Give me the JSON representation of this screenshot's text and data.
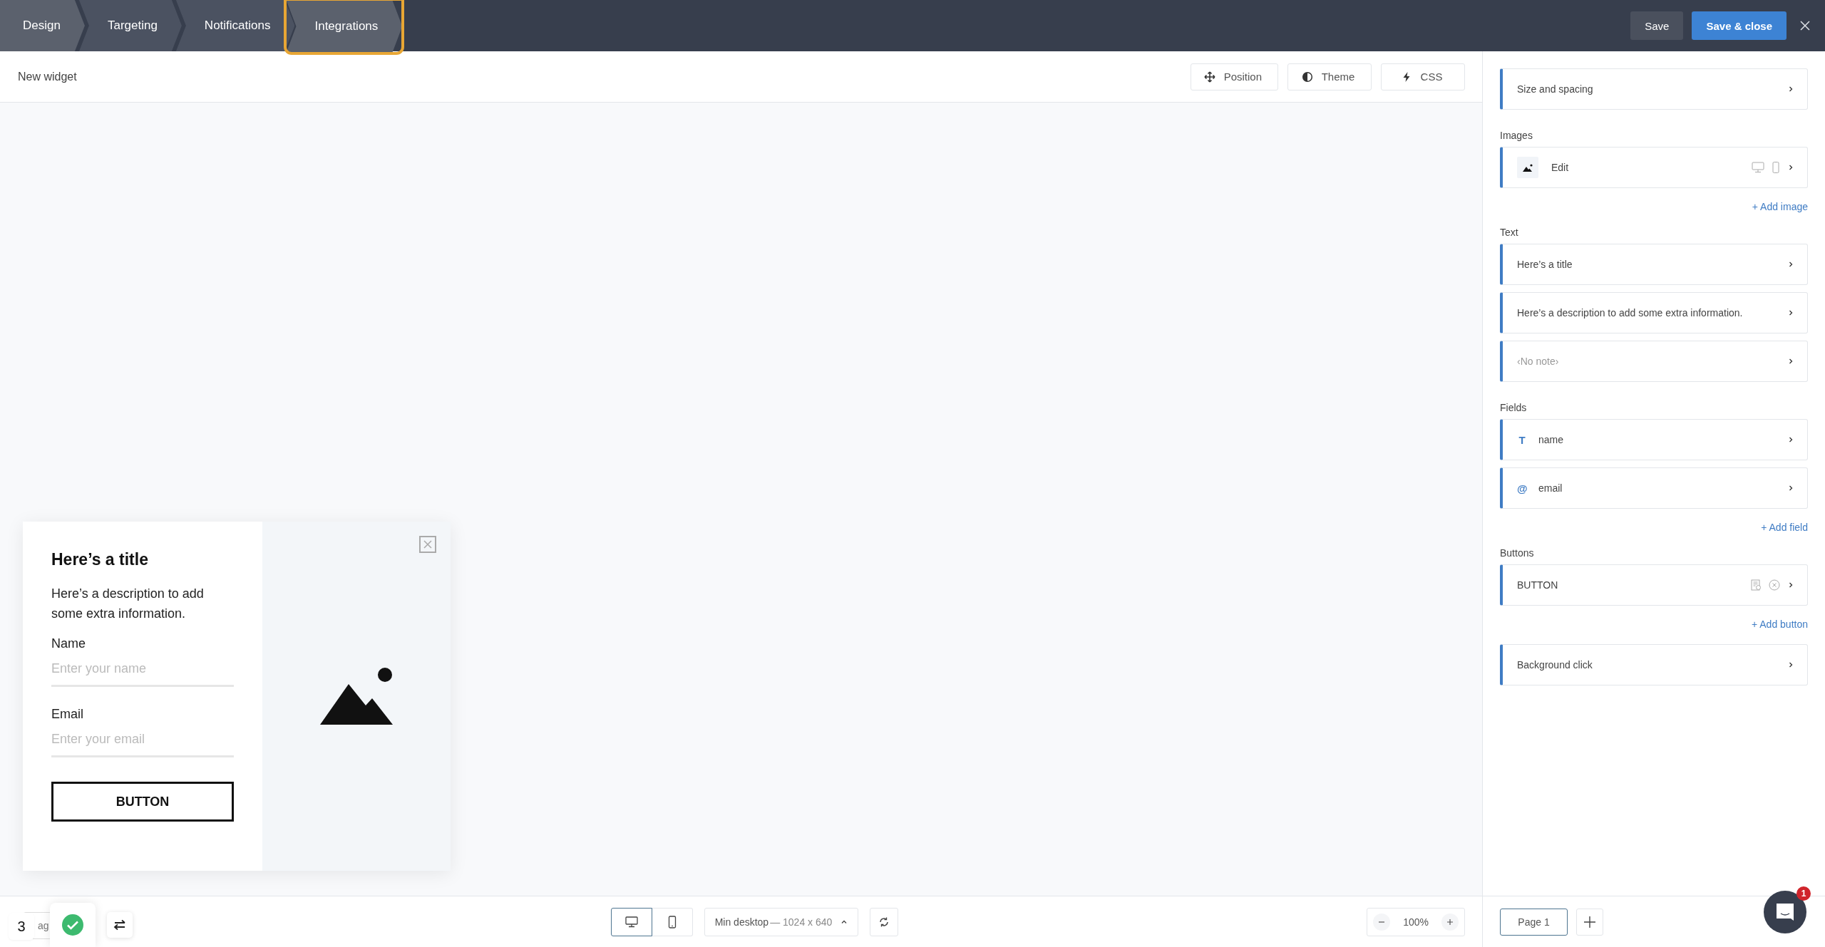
{
  "tabs": [
    {
      "label": "Design",
      "selected": true,
      "highlighted": false
    },
    {
      "label": "Targeting",
      "selected": false,
      "highlighted": false
    },
    {
      "label": "Notifications",
      "selected": false,
      "highlighted": false
    },
    {
      "label": "Integrations",
      "selected": true,
      "highlighted": true
    }
  ],
  "header_buttons": [
    {
      "label": "Save",
      "kind": "secondary"
    },
    {
      "label": "Save & close",
      "kind": "primary"
    }
  ],
  "widget_name": "New widget",
  "toolbar": [
    {
      "label": "Position",
      "kind": "position"
    },
    {
      "label": "Theme",
      "kind": "theme"
    },
    {
      "label": "CSS",
      "kind": "css"
    }
  ],
  "widget": {
    "title": "Here’s a title",
    "description": "Here’s a description to add some extra information.",
    "fields": [
      {
        "label": "Name",
        "placeholder": "Enter your name"
      },
      {
        "label": "Email",
        "placeholder": "Enter your email"
      }
    ],
    "button": "BUTTON"
  },
  "panel": {
    "sections": [
      {
        "items": [
          {
            "kind": "plain",
            "label": "Size and spacing"
          }
        ]
      },
      {
        "heading": "Images",
        "items": [
          {
            "kind": "image",
            "label": "Edit"
          }
        ],
        "add": "+ Add image"
      },
      {
        "heading": "Text",
        "items": [
          {
            "kind": "plain",
            "label": "Here’s a title"
          },
          {
            "kind": "plain",
            "label": "Here’s a description to add some extra information."
          },
          {
            "kind": "empty",
            "label": "‹No note›"
          }
        ]
      },
      {
        "heading": "Fields",
        "items": [
          {
            "kind": "field",
            "icon": "T",
            "label": "name"
          },
          {
            "kind": "field",
            "icon": "@",
            "label": "email"
          }
        ],
        "add": "+ Add field"
      },
      {
        "heading": "Buttons",
        "items": [
          {
            "kind": "button",
            "label": "BUTTON"
          }
        ],
        "add": "+ Add button"
      },
      {
        "items": [
          {
            "kind": "plain",
            "label": "Background click"
          }
        ]
      }
    ]
  },
  "bottom_bar": {
    "step": "3",
    "hidden_label": "ag",
    "devices": [
      {
        "kind": "desktop",
        "selected": true
      },
      {
        "kind": "mobile",
        "selected": false
      }
    ],
    "viewport": {
      "name": "Min desktop",
      "size": "— 1024 x 640"
    },
    "zoom": "100%",
    "pages": [
      {
        "label": "Page 1",
        "selected": true
      }
    ],
    "chat_badge": "1"
  }
}
